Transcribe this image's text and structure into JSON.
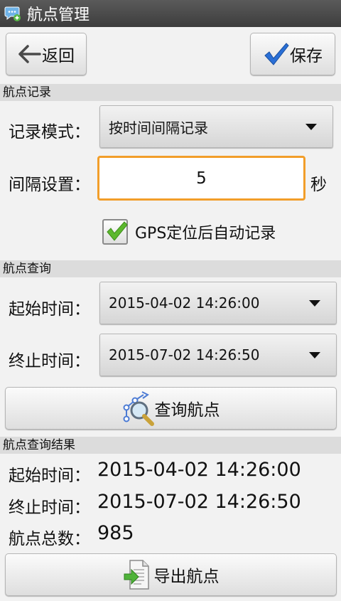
{
  "app": {
    "title": "航点管理"
  },
  "toolbar": {
    "back_label": "返回",
    "save_label": "保存"
  },
  "record": {
    "section_title": "航点记录",
    "mode_label": "记录模式：",
    "mode_value": "按时间间隔记录",
    "interval_label": "间隔设置：",
    "interval_value": "5",
    "interval_unit": "秒",
    "gps_auto_label": "GPS定位后自动记录",
    "gps_auto_checked": true
  },
  "query": {
    "section_title": "航点查询",
    "start_label": "起始时间：",
    "start_value": "2015-04-02 14:26:00",
    "end_label": "终止时间：",
    "end_value": "2015-07-02 14:26:50",
    "button_label": "查询航点"
  },
  "result": {
    "section_title": "航点查询结果",
    "start_label": "起始时间：",
    "start_value": "2015-04-02 14:26:00",
    "end_label": "终止时间：",
    "end_value": "2015-07-02 14:26:50",
    "count_label": "航点总数：",
    "count_value": "985",
    "export_label": "导出航点"
  },
  "colors": {
    "accent_orange": "#f29e2a",
    "check_green": "#5cb82e",
    "back_arrow": "#4a4a4a",
    "save_check_blue": "#2a6fd6"
  },
  "icons": [
    "app-icon",
    "back-arrow-icon",
    "save-check-icon",
    "dropdown-arrow-icon",
    "query-waypoint-icon",
    "export-document-icon"
  ]
}
